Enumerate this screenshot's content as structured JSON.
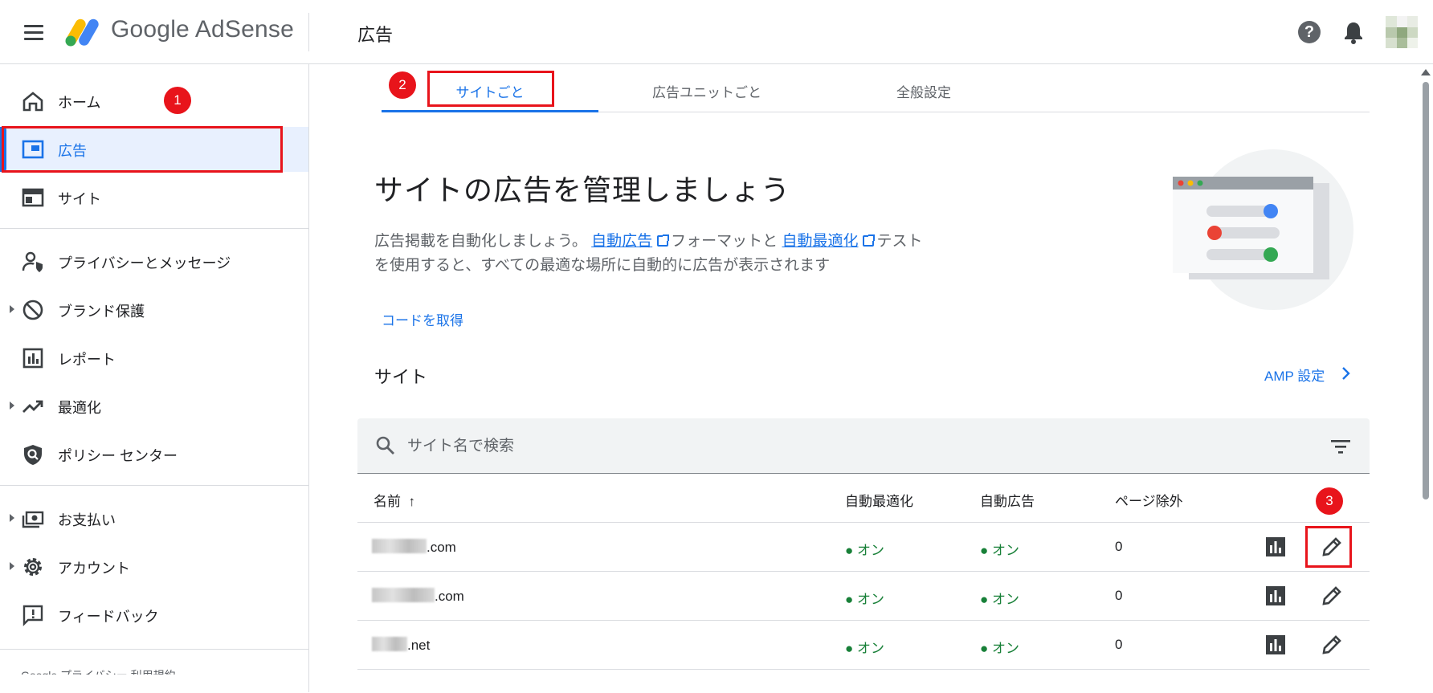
{
  "header": {
    "brand": "Google AdSense",
    "page_title": "広告"
  },
  "sidebar": {
    "items": [
      {
        "label": "ホーム",
        "icon": "home-icon"
      },
      {
        "label": "広告",
        "icon": "ads-icon",
        "active": true
      },
      {
        "label": "サイト",
        "icon": "sites-icon"
      },
      {
        "label": "プライバシーとメッセージ",
        "icon": "privacy-icon"
      },
      {
        "label": "ブランド保護",
        "icon": "block-icon"
      },
      {
        "label": "レポート",
        "icon": "report-icon"
      },
      {
        "label": "最適化",
        "icon": "trending-icon"
      },
      {
        "label": "ポリシー センター",
        "icon": "policy-icon"
      },
      {
        "label": "お支払い",
        "icon": "payments-icon"
      },
      {
        "label": "アカウント",
        "icon": "gear-icon"
      },
      {
        "label": "フィードバック",
        "icon": "feedback-icon"
      }
    ],
    "footer_partial": "Google プライバシー 利用規約"
  },
  "tabs": [
    {
      "label": "サイトごと",
      "active": true
    },
    {
      "label": "広告ユニットごと"
    },
    {
      "label": "全般設定"
    }
  ],
  "annotations": [
    "1",
    "2",
    "3"
  ],
  "hero": {
    "title": "サイトの広告を管理しましょう",
    "text_1": "広告掲載を自動化しましょう。",
    "link_auto_ads": "自動広告",
    "text_2": "フォーマットと",
    "link_auto_opt": "自動最適化",
    "text_3": "テスト",
    "text_line2": "を使用すると、すべての最適な場所に自動的に広告が表示されます",
    "get_code": "コードを取得"
  },
  "sites": {
    "heading": "サイト",
    "amp_link": "AMP 設定",
    "search_placeholder": "サイト名で検索",
    "columns": {
      "name": "名前",
      "sort_arrow": "↑",
      "auto_opt": "自動最適化",
      "auto_ads": "自動広告",
      "page_exclusions": "ページ除外"
    },
    "rows": [
      {
        "name_suffix": ".com",
        "auto_opt": "オン",
        "auto_ads": "オン",
        "exclusions": "0"
      },
      {
        "name_suffix": ".com",
        "auto_opt": "オン",
        "auto_ads": "オン",
        "exclusions": "0"
      },
      {
        "name_suffix": ".net",
        "auto_opt": "オン",
        "auto_ads": "オン",
        "exclusions": "0"
      }
    ]
  },
  "colors": {
    "accent": "#1a73e8",
    "status_on": "#188038",
    "annotation_red": "#e8141b"
  }
}
